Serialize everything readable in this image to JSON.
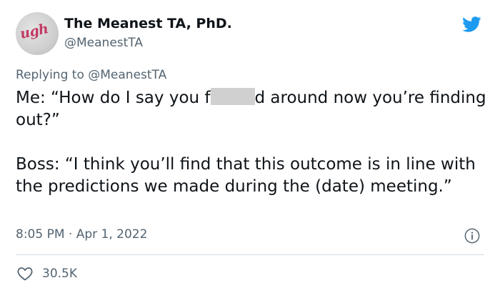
{
  "tweet": {
    "display_name": "The Meanest TA, PhD.",
    "handle": "@MeanestTA",
    "avatar_text": "ugh",
    "replying_to": "Replying to @MeanestTA",
    "body": {
      "line1_before_censor": "Me: “How do I say you f",
      "line1_after_censor": "d around now you’re finding out?”",
      "paragraph2": "Boss: “I think you’ll find that this outcome is in line with the predictions we made during the (date) meeting.”"
    },
    "timestamp": "8:05 PM · Apr 1, 2022",
    "like_count": "30.5K"
  },
  "colors": {
    "twitter_blue": "#1d9bf0",
    "secondary_text": "#536471",
    "primary_text": "#0f1419",
    "divider": "#cfd9de",
    "avatar_text": "#c23a63"
  },
  "icons": {
    "brand": "twitter-bird-icon",
    "info": "info-icon",
    "like": "heart-icon"
  }
}
